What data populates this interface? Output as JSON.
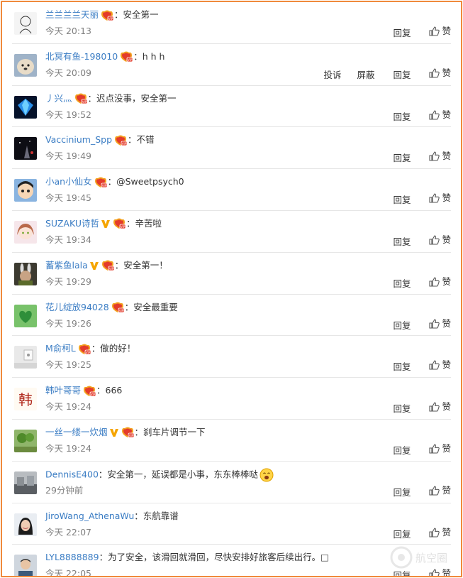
{
  "actions": {
    "report": "投诉",
    "block": "屏蔽",
    "reply": "回复",
    "like": "赞"
  },
  "comments": [
    {
      "user": "兰兰兰兰天丽",
      "text": "：安全第一",
      "time": "今天 20:13",
      "vip": true,
      "verified": false,
      "emoji": false,
      "extra_actions": false,
      "avatar": "avatar-sketch"
    },
    {
      "user": "北冥有鱼-198010",
      "text": "：h h h",
      "time": "今天 20:09",
      "vip": true,
      "verified": false,
      "emoji": false,
      "extra_actions": true,
      "avatar": "avatar-dog"
    },
    {
      "user": "丿兴灬",
      "text": "：迟点没事，安全第一",
      "time": "今天 19:52",
      "vip": true,
      "verified": false,
      "emoji": false,
      "extra_actions": false,
      "avatar": "avatar-diamond"
    },
    {
      "user": "Vaccinium_Spp",
      "text": "：不错",
      "time": "今天 19:49",
      "vip": true,
      "verified": false,
      "emoji": false,
      "extra_actions": false,
      "avatar": "avatar-night"
    },
    {
      "user": "小an小仙女",
      "text": "：@Sweetpsych0",
      "time": "今天 19:45",
      "vip": true,
      "verified": false,
      "emoji": false,
      "extra_actions": false,
      "avatar": "avatar-cartoon"
    },
    {
      "user": "SUZAKU诗哲",
      "text": "：辛苦啦",
      "time": "今天 19:34",
      "vip": true,
      "verified": true,
      "emoji": false,
      "extra_actions": false,
      "avatar": "avatar-anime"
    },
    {
      "user": "蓄紫鱼lala",
      "text": "：安全第一！",
      "time": "今天 19:29",
      "vip": true,
      "verified": true,
      "emoji": false,
      "extra_actions": false,
      "avatar": "avatar-bunny"
    },
    {
      "user": "花儿绽放94028",
      "text": "：安全最重要",
      "time": "今天 19:26",
      "vip": true,
      "verified": false,
      "emoji": false,
      "extra_actions": false,
      "avatar": "avatar-heart"
    },
    {
      "user": "M俞柯L",
      "text": "：做的好！",
      "time": "今天 19:25",
      "vip": true,
      "verified": false,
      "emoji": false,
      "extra_actions": false,
      "avatar": "avatar-wall"
    },
    {
      "user": "韩叶哥哥",
      "text": "：666",
      "time": "今天 19:24",
      "vip": true,
      "verified": false,
      "emoji": false,
      "extra_actions": false,
      "avatar": "avatar-han"
    },
    {
      "user": "一丝一缕一炊烟",
      "text": "：刹车片调节一下",
      "time": "今天 19:24",
      "vip": true,
      "verified": true,
      "emoji": false,
      "extra_actions": false,
      "avatar": "avatar-tree"
    },
    {
      "user": "DennisE400",
      "text": "：安全第一，延误都是小事，东东棒棒哒",
      "time": "29分钟前",
      "vip": false,
      "verified": false,
      "emoji": true,
      "extra_actions": false,
      "avatar": "avatar-street"
    },
    {
      "user": "JiroWang_AthenaWu",
      "text": "：东航靠谱",
      "time": "今天 22:07",
      "vip": false,
      "verified": false,
      "emoji": false,
      "extra_actions": false,
      "avatar": "avatar-woman"
    },
    {
      "user": "LYL8888889",
      "text": "：为了安全，该滑回就滑回，尽快安排好旅客后续出行。□",
      "time": "今天 22:05",
      "vip": false,
      "verified": false,
      "emoji": false,
      "extra_actions": false,
      "avatar": "avatar-man"
    }
  ],
  "watermark": "航空圈",
  "colors": {
    "frame": "#f08a3c",
    "username": "#3b7dc4",
    "time": "#808080",
    "divider": "#e6e6e6"
  }
}
